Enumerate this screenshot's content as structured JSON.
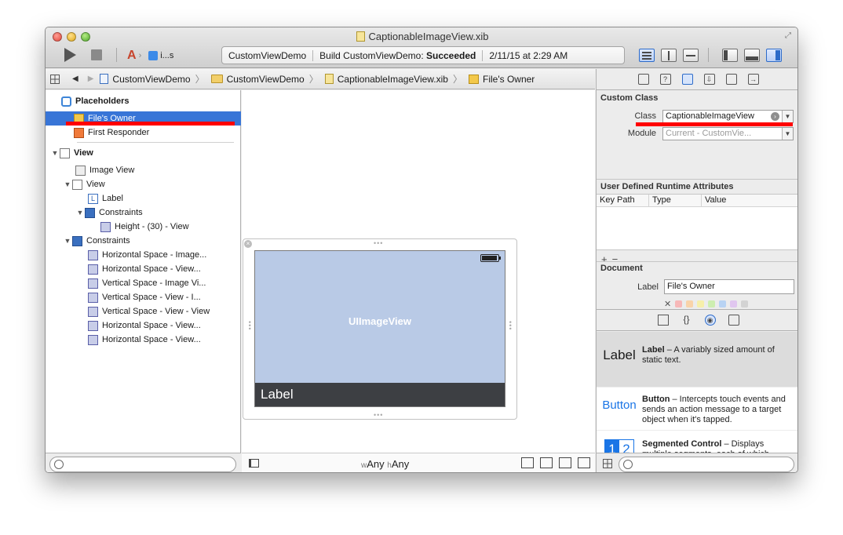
{
  "window": {
    "title": "CaptionableImageView.xib"
  },
  "toolbar": {
    "scheme_label": "i...s",
    "status_project": "CustomViewDemo",
    "status_build_prefix": "Build CustomViewDemo:",
    "status_build_result": "Succeeded",
    "status_time": "2/11/15 at 2:29 AM"
  },
  "jumpbar": {
    "crumbs": [
      "CustomViewDemo",
      "CustomViewDemo",
      "CaptionableImageView.xib",
      "File's Owner"
    ]
  },
  "outline": {
    "placeholders_heading": "Placeholders",
    "files_owner": "File's Owner",
    "first_responder": "First Responder",
    "view_root": "View",
    "image_view": "Image View",
    "inner_view": "View",
    "label": "Label",
    "inner_constraints": "Constraints",
    "height_constraint": "Height - (30) - View",
    "root_constraints": "Constraints",
    "constraint_items": [
      "Horizontal Space - Image...",
      "Horizontal Space - View...",
      "Vertical Space - Image Vi...",
      "Vertical Space - View - I...",
      "Vertical Space - View - View",
      "Horizontal Space - View...",
      "Horizontal Space - View..."
    ]
  },
  "canvas": {
    "image_view_label": "UIImageView",
    "caption_label": "Label",
    "size_w_prefix": "w",
    "size_w_value": "Any",
    "size_h_prefix": "h",
    "size_h_value": "Any"
  },
  "inspector": {
    "custom_class_heading": "Custom Class",
    "class_label": "Class",
    "class_value": "CaptionableImageView",
    "module_label": "Module",
    "module_value": "Current - CustomVie...",
    "udra_heading": "User Defined Runtime Attributes",
    "udra_columns": [
      "Key Path",
      "Type",
      "Value"
    ],
    "document_heading": "Document",
    "doc_label_label": "Label",
    "doc_label_value": "File's Owner"
  },
  "library": {
    "items": [
      {
        "thumb": "Label",
        "name": "Label",
        "desc": " – A variably sized amount of static text."
      },
      {
        "thumb": "Button",
        "name": "Button",
        "desc": " – Intercepts touch events and sends an action message to a target object when it's tapped."
      },
      {
        "thumb_1": "1",
        "thumb_2": "2",
        "name": "Segmented Control",
        "desc": " – Displays multiple segments, each of which functions as a discrete button."
      }
    ]
  },
  "colors": {
    "selection": "#3875d7",
    "highlight_annotation": "#ff0000",
    "image_view_fill": "#b9cae6",
    "caption_bar": "#3d3f43",
    "ios_blue": "#1a75e6"
  }
}
